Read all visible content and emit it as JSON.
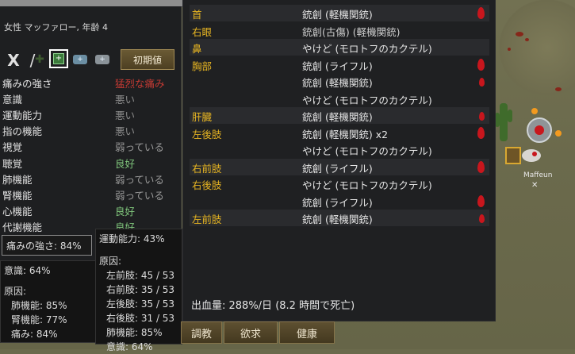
{
  "colnist": {
    "subject": "女性 マッファロー, 年齢 4"
  },
  "toolbar": {
    "close_label": "X",
    "edit_label": "/",
    "reset_label": "初期値",
    "med_a_label": "+",
    "med_b_label": "+",
    "box_label": "+"
  },
  "capacities": [
    {
      "name": "痛みの強さ",
      "value": "猛烈な痛み",
      "color": "#c43a33"
    },
    {
      "name": "意識",
      "value": "悪い",
      "color": "#8d8d8d"
    },
    {
      "name": "運動能力",
      "value": "悪い",
      "color": "#8d8d8d"
    },
    {
      "name": "指の機能",
      "value": "悪い",
      "color": "#8d8d8d"
    },
    {
      "name": "視覚",
      "value": "弱っている",
      "color": "#9a9a9a"
    },
    {
      "name": "聴覚",
      "value": "良好",
      "color": "#7fc47b"
    },
    {
      "name": "肺機能",
      "value": "弱っている",
      "color": "#9a9a9a"
    },
    {
      "name": "腎機能",
      "value": "弱っている",
      "color": "#9a9a9a"
    },
    {
      "name": "心機能",
      "value": "良好",
      "color": "#7fc47b"
    },
    {
      "name": "代謝機能",
      "value": "良好",
      "color": "#7fc47b"
    }
  ],
  "tooltips": {
    "pain": "痛みの強さ: 84%",
    "consciousness": {
      "title": "意識: 64%",
      "cause": "原因:",
      "items": [
        "肺機能: 85%",
        "腎機能: 77%",
        "痛み: 84%"
      ]
    },
    "moving": {
      "title": "運動能力: 43%",
      "cause": "原因:",
      "items": [
        "左前肢: 45 / 53",
        "右前肢: 35 / 53",
        "左後肢: 35 / 53",
        "右後肢: 31 / 53",
        "肺機能: 85%",
        "意識: 64%"
      ]
    }
  },
  "tabs": [
    {
      "label": "調教"
    },
    {
      "label": "欲求"
    },
    {
      "label": "健康"
    }
  ],
  "hediffs": [
    {
      "part": "首",
      "injury": "銃創 (軽機関銃)",
      "drop": "big",
      "alt": true
    },
    {
      "part": "右眼",
      "injury": "銃創(古傷) (軽機関銃)",
      "drop": "",
      "alt": false,
      "scar": true
    },
    {
      "part": "鼻",
      "injury": "やけど (モロトフのカクテル)",
      "drop": "",
      "alt": true
    },
    {
      "part": "胸部",
      "injury": "銃創 (ライフル)",
      "drop": "big",
      "alt": false
    },
    {
      "part": "",
      "injury": "銃創 (軽機関銃)",
      "drop": "small",
      "alt": false
    },
    {
      "part": "",
      "injury": "やけど (モロトフのカクテル)",
      "drop": "",
      "alt": false
    },
    {
      "part": "肝臓",
      "injury": "銃創 (軽機関銃)",
      "drop": "small",
      "alt": true
    },
    {
      "part": "左後肢",
      "injury": "銃創 (軽機関銃) x2",
      "drop": "big",
      "alt": false
    },
    {
      "part": "",
      "injury": "やけど (モロトフのカクテル)",
      "drop": "",
      "alt": false
    },
    {
      "part": "右前肢",
      "injury": "銃創 (ライフル)",
      "drop": "big",
      "alt": true
    },
    {
      "part": "右後肢",
      "injury": "やけど (モロトフのカクテル)",
      "drop": "",
      "alt": false
    },
    {
      "part": "",
      "injury": "銃創 (ライフル)",
      "drop": "big",
      "alt": false
    },
    {
      "part": "左前肢",
      "injury": "銃創 (軽機関銃)",
      "drop": "small",
      "alt": true
    }
  ],
  "bleeding": "出血量: 288%/日 (8.2 時間で死亡)",
  "map": {
    "pawn_label": "Maffeun"
  }
}
